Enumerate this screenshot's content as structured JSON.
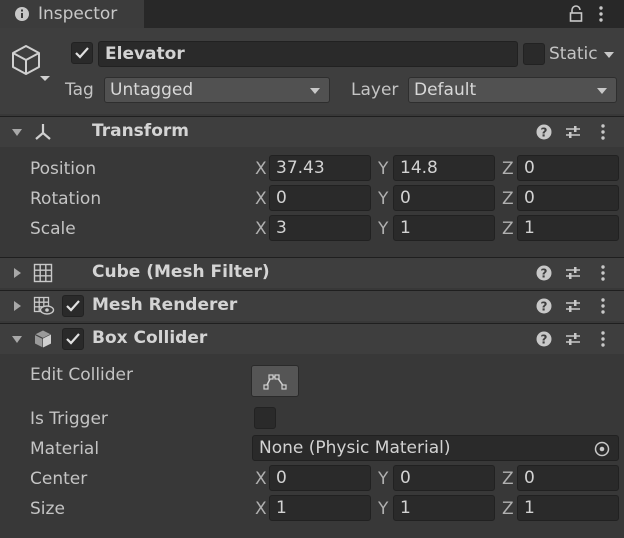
{
  "tab": {
    "icon": "info-icon",
    "title": "Inspector",
    "lock_icon": "lock-icon",
    "menu_icon": "kebab-icon"
  },
  "object": {
    "icon": "cube-outline-icon",
    "name": "Elevator",
    "static_label": "Static",
    "tag_label": "Tag",
    "tag_value": "Untagged",
    "layer_label": "Layer",
    "layer_value": "Default"
  },
  "transform": {
    "title": "Transform",
    "icon": "transform-axes-icon",
    "rows": [
      {
        "label": "Position",
        "x": "37.43",
        "y": "14.8",
        "z": "0"
      },
      {
        "label": "Rotation",
        "x": "0",
        "y": "0",
        "z": "0"
      },
      {
        "label": "Scale",
        "x": "3",
        "y": "1",
        "z": "1"
      }
    ]
  },
  "axis": {
    "x": "X",
    "y": "Y",
    "z": "Z"
  },
  "mesh_filter": {
    "title": "Cube (Mesh Filter)",
    "icon": "grid-icon"
  },
  "mesh_renderer": {
    "title": "Mesh Renderer",
    "icon": "mesh-renderer-icon"
  },
  "box_collider": {
    "title": "Box Collider",
    "icon": "box-collider-icon",
    "edit_label": "Edit Collider",
    "trigger_label": "Is Trigger",
    "material_label": "Material",
    "material_value": "None (Physic Material)",
    "center_label": "Center",
    "center": {
      "x": "0",
      "y": "0",
      "z": "0"
    },
    "size_label": "Size",
    "size": {
      "x": "1",
      "y": "1",
      "z": "1"
    }
  },
  "colors": {
    "background": "#383838",
    "field": "#2a2a2a",
    "header": "#3e3e3e",
    "tabbar": "#282828"
  }
}
